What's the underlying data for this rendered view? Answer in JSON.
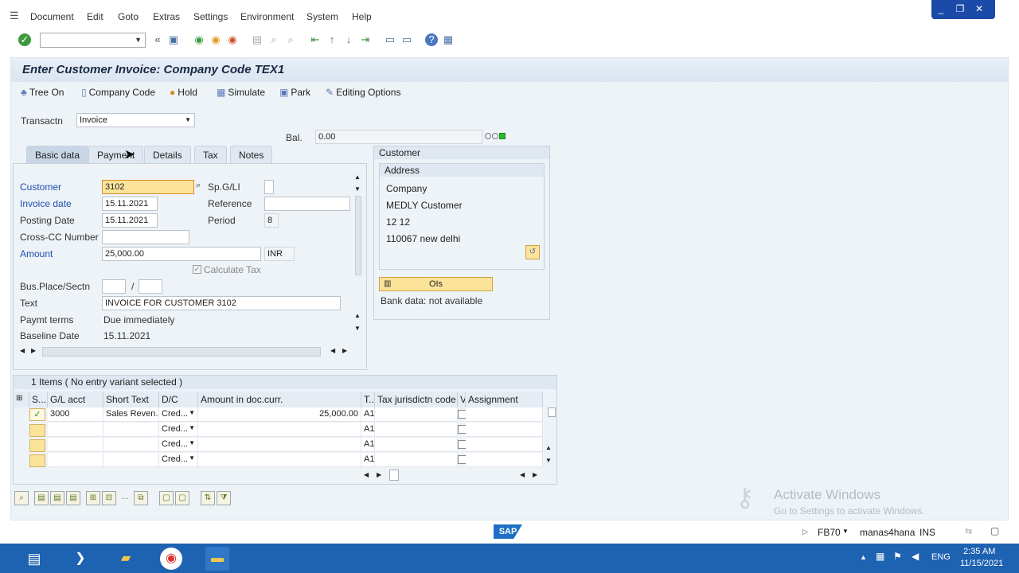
{
  "menu": [
    "Document",
    "Edit",
    "Goto",
    "Extras",
    "Settings",
    "Environment",
    "System",
    "Help"
  ],
  "window_controls": [
    "_",
    "❐",
    "✕"
  ],
  "title": "Enter Customer Invoice: Company Code TEX1",
  "app_toolbar": {
    "tree_on": "Tree On",
    "company_code": "Company Code",
    "hold": "Hold",
    "simulate": "Simulate",
    "park": "Park",
    "editing_options": "Editing Options"
  },
  "transaction": {
    "label": "Transactn",
    "value": "Invoice"
  },
  "balance": {
    "label": "Bal.",
    "value": "0.00"
  },
  "tabs": [
    "Basic data",
    "Payment",
    "Details",
    "Tax",
    "Notes"
  ],
  "form": {
    "customer_label": "Customer",
    "customer_value": "3102",
    "spgl_label": "Sp.G/LI",
    "invoice_date_label": "Invoice date",
    "invoice_date_value": "15.11.2021",
    "reference_label": "Reference",
    "posting_date_label": "Posting Date",
    "posting_date_value": "15.11.2021",
    "period_label": "Period",
    "period_value": "8",
    "crosscc_label": "Cross-CC Number",
    "amount_label": "Amount",
    "amount_value": "25,000.00",
    "currency": "INR",
    "calc_tax_label": "Calculate Tax",
    "busplace_label": "Bus.Place/Sectn",
    "busplace_sep": "/",
    "text_label": "Text",
    "text_value": "INVOICE FOR CUSTOMER 3102",
    "paymt_terms_label": "Paymt terms",
    "paymt_terms_value": "Due immediately",
    "baseline_label": "Baseline Date",
    "baseline_value": "15.11.2021"
  },
  "customer_panel": {
    "title": "Customer",
    "address_title": "Address",
    "lines": [
      "Company",
      "MEDLY Customer",
      "12 12",
      "110067 new delhi"
    ],
    "ois_label": "OIs",
    "bank_data": "Bank data: not available"
  },
  "items": {
    "header": "1 Items ( No entry variant selected )",
    "columns": [
      "S...",
      "G/L acct",
      "Short Text",
      "D/C",
      "Amount in doc.curr.",
      "T...",
      "Tax jurisdictn code",
      "V",
      "Assignment"
    ],
    "rows": [
      {
        "gl": "3000",
        "short_text": "Sales Reven...",
        "dc": "Cred...",
        "amount": "25,000.00",
        "tax": "A1"
      },
      {
        "gl": "",
        "short_text": "",
        "dc": "Cred...",
        "amount": "",
        "tax": "A1"
      },
      {
        "gl": "",
        "short_text": "",
        "dc": "Cred...",
        "amount": "",
        "tax": "A1"
      },
      {
        "gl": "",
        "short_text": "",
        "dc": "Cred...",
        "amount": "",
        "tax": "A1"
      }
    ]
  },
  "watermark": {
    "line1": "Activate Windows",
    "line2": "Go to Settings to activate Windows."
  },
  "status": {
    "transaction": "FB70",
    "system": "manas4hana",
    "mode": "INS",
    "logo": "SAP"
  },
  "taskbar": {
    "lang": "ENG",
    "time": "2:35 AM",
    "date": "11/15/2021"
  }
}
